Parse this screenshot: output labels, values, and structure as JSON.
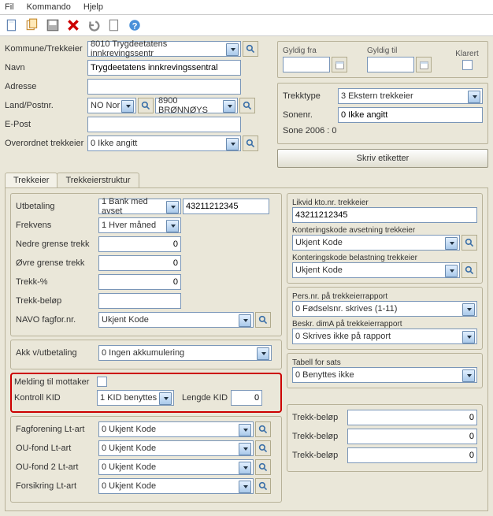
{
  "menubar": {
    "fil": "Fil",
    "kommando": "Kommando",
    "hjelp": "Hjelp"
  },
  "left": {
    "kommune_label": "Kommune/Trekkeier",
    "kommune_value": "8010 Trygdeetatens innkrevingssentr",
    "navn_label": "Navn",
    "navn_value": "Trygdeetatens innkrevingssentral",
    "adresse_label": "Adresse",
    "adresse_value": "",
    "land_label": "Land/Postnr.",
    "land_value": "NO Nor",
    "post_value": "8900 BRØNNØYS",
    "epost_label": "E-Post",
    "epost_value": "",
    "overordnet_label": "Overordnet trekkeier",
    "overordnet_value": "0 Ikke angitt"
  },
  "right": {
    "gyldigfra": "Gyldig fra",
    "gyldigtil": "Gyldig til",
    "klarert": "Klarert",
    "trekktype_label": "Trekktype",
    "trekktype_value": "3 Ekstern trekkeier",
    "sonenr_label": "Sonenr.",
    "sonenr_value": "0 Ikke angitt",
    "sone2006": "Sone 2006 : 0",
    "skriv": "Skriv etiketter"
  },
  "tabs": {
    "t1": "Trekkeier",
    "t2": "Trekkeierstruktur"
  },
  "pay": {
    "utb_label": "Utbetaling",
    "utb_value": "1 Bank med avset",
    "utb_num": "43211212345",
    "frek_label": "Frekvens",
    "frek_value": "1 Hver måned",
    "nedre_label": "Nedre grense trekk",
    "nedre_value": "0",
    "ovre_label": "Øvre grense trekk",
    "ovre_value": "0",
    "pct_label": "Trekk-%",
    "pct_value": "0",
    "belop_label": "Trekk-beløp",
    "belop_value": "",
    "navo_label": "NAVO fagfor.nr.",
    "navo_value": "Ukjent Kode"
  },
  "acc": {
    "akk_label": "Akk v/utbetaling",
    "akk_value": "0 Ingen akkumulering",
    "melding_label": "Melding til mottaker",
    "kontroll_label": "Kontroll KID",
    "kontroll_value": "1 KID benyttes",
    "lengde_label": "Lengde KID",
    "lengde_value": "0"
  },
  "rightpanel": {
    "likvid_label": "Likvid kto.nr. trekkeier",
    "likvid_value": "43211212345",
    "kavs_label": "Konteringskode avsetning trekkeier",
    "kavs_value": "Ukjent Kode",
    "kbel_label": "Konteringskode belastning trekkeier",
    "kbel_value": "Ukjent Kode",
    "pers_label": "Pers.nr. på trekkeierrapport",
    "pers_value": "0 Fødselsnr. skrives (1-11)",
    "beskr_label": "Beskr. dimA på trekkeierrapport",
    "beskr_value": "0 Skrives ikke på rapport",
    "tabell_label": "Tabell for sats",
    "tabell_value": "0 Benyttes ikke"
  },
  "bottom": {
    "fag_label": "Fagforening Lt-art",
    "fag_value": "0 Ukjent Kode",
    "ou_label": "OU-fond    Lt-art",
    "ou_value": "0 Ukjent Kode",
    "ou2_label": "OU-fond 2  Lt-art",
    "ou2_value": "0 Ukjent Kode",
    "fors_label": "Forsikring  Lt-art",
    "fors_value": "0 Ukjent Kode",
    "trekk_label": "Trekk-beløp",
    "trekk_value": "0"
  }
}
